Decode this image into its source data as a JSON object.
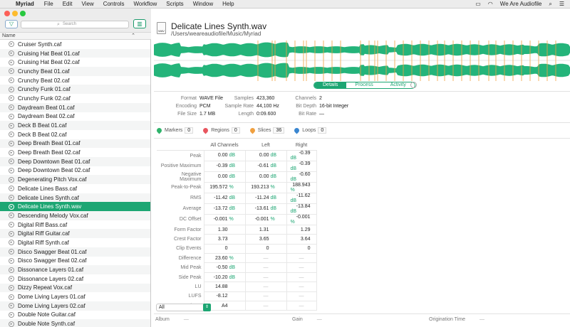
{
  "menubar": {
    "apple": "",
    "app": "Myriad",
    "items": [
      "File",
      "Edit",
      "View",
      "Controls",
      "Workflow",
      "Scripts",
      "Window",
      "Help"
    ],
    "user": "We Are Audiofile"
  },
  "toolbar": {
    "search_placeholder": "Search",
    "filter_icon": "filter-icon",
    "columns_icon": "columns-icon"
  },
  "list": {
    "column": "Name",
    "selected_index": 18,
    "items": [
      "Cruiser Synth.caf",
      "Cruising Hat Beat 01.caf",
      "Cruising Hat Beat 02.caf",
      "Crunchy Beat 01.caf",
      "Crunchy Beat 02.caf",
      "Crunchy Funk 01.caf",
      "Crunchy Funk 02.caf",
      "Daydream Beat 01.caf",
      "Daydream Beat 02.caf",
      "Deck B Beat 01.caf",
      "Deck B Beat 02.caf",
      "Deep Breath Beat 01.caf",
      "Deep Breath Beat 02.caf",
      "Deep Downtown Beat 01.caf",
      "Deep Downtown Beat 02.caf",
      "Degenerating Pitch Vox.caf",
      "Delicate Lines Bass.caf",
      "Delicate Lines Synth.caf",
      "Delicate Lines Synth.wav",
      "Descending Melody Vox.caf",
      "Digital Riff Bass.caf",
      "Digital Riff Guitar.caf",
      "Digital Riff Synth.caf",
      "Disco Swagger Beat 01.caf",
      "Disco Swagger Beat 02.caf",
      "Dissonance Layers 01.caf",
      "Dissonance Layers 02.caf",
      "Dizzy Repeat Vox.caf",
      "Dome Living Layers 01.caf",
      "Dome Living Layers 02.caf",
      "Double Note Guitar.caf",
      "Double Note Synth.caf"
    ]
  },
  "file": {
    "icon_label": "WAV",
    "name": "Delicate Lines Synth.wav",
    "path": "/Users/weareaudiofile/Music/Myriad"
  },
  "tabs": [
    "Details",
    "Process",
    "Activity"
  ],
  "props": {
    "col1": [
      [
        "Format",
        "WAVE File"
      ],
      [
        "Encoding",
        "PCM"
      ],
      [
        "File Size",
        "1.7 MB"
      ]
    ],
    "col2": [
      [
        "Samples",
        "423,360"
      ],
      [
        "Sample Rate",
        "44,100 Hz"
      ],
      [
        "Length",
        "0:09.600"
      ]
    ],
    "col3": [
      [
        "Channels",
        "2"
      ],
      [
        "Bit Depth",
        "16-bit Integer"
      ],
      [
        "Bit Rate",
        "—"
      ]
    ]
  },
  "markers": [
    {
      "label": "Markers",
      "count": "0",
      "color": "#2fb36b"
    },
    {
      "label": "Regions",
      "count": "0",
      "color": "#e8555e"
    },
    {
      "label": "Slices",
      "count": "36",
      "color": "#f0a040"
    },
    {
      "label": "Loops",
      "count": "0",
      "color": "#3a86d0"
    }
  ],
  "stats": {
    "headers": [
      "All Channels",
      "Left",
      "Right"
    ],
    "rows": [
      {
        "label": "Peak",
        "v": [
          [
            "0.00",
            "dB"
          ],
          [
            "0.00",
            "dB"
          ],
          [
            "-0.39",
            "dB"
          ]
        ]
      },
      {
        "label": "Positive Maximum",
        "v": [
          [
            "-0.39",
            "dB"
          ],
          [
            "-0.61",
            "dB"
          ],
          [
            "-0.39",
            "dB"
          ]
        ]
      },
      {
        "label": "Negative Maximum",
        "v": [
          [
            "0.00",
            "dB"
          ],
          [
            "0.00",
            "dB"
          ],
          [
            "-0.60",
            "dB"
          ]
        ]
      },
      {
        "label": "Peak-to-Peak",
        "v": [
          [
            "195.572",
            "%"
          ],
          [
            "193.213",
            "%"
          ],
          [
            "188.943",
            "%"
          ]
        ]
      },
      {
        "label": "RMS",
        "v": [
          [
            "-11.42",
            "dB"
          ],
          [
            "-11.24",
            "dB"
          ],
          [
            "-11.62",
            "dB"
          ]
        ]
      },
      {
        "label": "Average",
        "v": [
          [
            "-13.72",
            "dB"
          ],
          [
            "-13.61",
            "dB"
          ],
          [
            "-13.84",
            "dB"
          ]
        ]
      },
      {
        "label": "DC Offset",
        "v": [
          [
            "-0.001",
            "%"
          ],
          [
            "-0.001",
            "%"
          ],
          [
            "-0.001",
            "%"
          ]
        ]
      },
      {
        "label": "Form Factor",
        "v": [
          [
            "1.30",
            ""
          ],
          [
            "1.31",
            ""
          ],
          [
            "1.29",
            ""
          ]
        ]
      },
      {
        "label": "Crest Factor",
        "v": [
          [
            "3.73",
            ""
          ],
          [
            "3.65",
            ""
          ],
          [
            "3.64",
            ""
          ]
        ]
      },
      {
        "label": "Clip Events",
        "v": [
          [
            "0",
            ""
          ],
          [
            "0",
            ""
          ],
          [
            "0",
            ""
          ]
        ]
      },
      {
        "label": "Difference",
        "v": [
          [
            "23.60",
            "%"
          ],
          [
            "—",
            ""
          ],
          [
            "—",
            ""
          ]
        ]
      },
      {
        "label": "Mid Peak",
        "v": [
          [
            "-0.50",
            "dB"
          ],
          [
            "—",
            ""
          ],
          [
            "—",
            ""
          ]
        ]
      },
      {
        "label": "Side Peak",
        "v": [
          [
            "-10.20",
            "dB"
          ],
          [
            "—",
            ""
          ],
          [
            "—",
            ""
          ]
        ]
      },
      {
        "label": "LU",
        "v": [
          [
            "14.88",
            ""
          ],
          [
            "—",
            ""
          ],
          [
            "—",
            ""
          ]
        ]
      },
      {
        "label": "LUFS",
        "v": [
          [
            "-8.12",
            ""
          ],
          [
            "—",
            ""
          ],
          [
            "—",
            ""
          ]
        ]
      },
      {
        "label": "Semitone",
        "v": [
          [
            "A4",
            ""
          ],
          [
            "—",
            ""
          ],
          [
            "—",
            ""
          ]
        ]
      }
    ]
  },
  "filter_select": "All",
  "meta": [
    [
      "Album",
      "—"
    ],
    [
      "Gain",
      "—"
    ],
    [
      "Origination Time",
      "—"
    ]
  ],
  "colors": {
    "accent": "#1da673",
    "wave": "#24b47a",
    "slice": "#f0a040"
  }
}
